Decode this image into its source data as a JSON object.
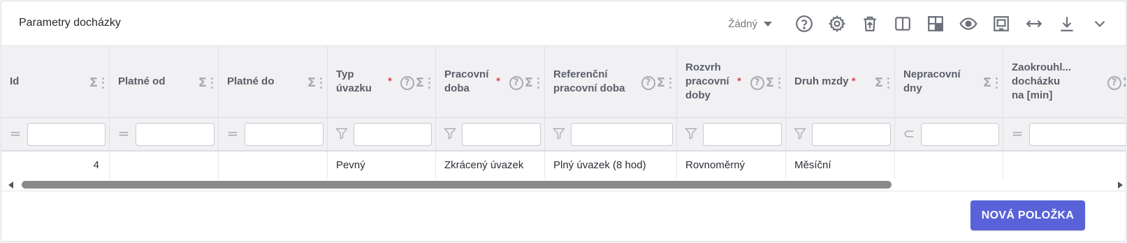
{
  "panel": {
    "title": "Parametry docházky",
    "view_select": "Žádný"
  },
  "toolbar": {
    "icons": [
      "help-icon",
      "gear-icon",
      "trash-upload-icon",
      "columns-icon",
      "layout-icon",
      "eye-icon",
      "fit-icon",
      "horizontal-arrows-icon",
      "download-icon",
      "chevron-down-icon"
    ]
  },
  "columns": [
    {
      "label": "Id",
      "required": "",
      "help": false,
      "filter_op": "="
    },
    {
      "label": "Platné od",
      "required": "",
      "help": false,
      "filter_op": "="
    },
    {
      "label": "Platné do",
      "required": "",
      "help": false,
      "filter_op": "="
    },
    {
      "label": "Typ úvazku",
      "required": "*",
      "help": true,
      "filter_op": "funnel"
    },
    {
      "label": "Pracovní doba",
      "required": "*",
      "help": true,
      "filter_op": "funnel"
    },
    {
      "label": "Referenční pracovní doba",
      "required": "",
      "help": true,
      "filter_op": "funnel"
    },
    {
      "label": "Rozvrh pracovní doby",
      "required": "*",
      "help": true,
      "filter_op": "funnel"
    },
    {
      "label": "Druh mzdy",
      "required": "*",
      "help": false,
      "filter_op": "funnel"
    },
    {
      "label": "Nepracovní dny",
      "required": "",
      "help": false,
      "filter_op": "⊂"
    },
    {
      "label": "Zaokrouhl... docházku na [min]",
      "required": "",
      "help": true,
      "filter_op": "="
    }
  ],
  "rows": [
    {
      "cells": [
        "4",
        "",
        "",
        "Pevný",
        "Zkrácený úvazek",
        "Plný úvazek (8 hod)",
        "Rovnoměrný",
        "Měsíční",
        "",
        ""
      ]
    }
  ],
  "sigma": "Σ",
  "help_glyph": "?",
  "footer": {
    "new_button": "NOVÁ POLOŽKA"
  },
  "colors": {
    "accent": "#5a62d9",
    "required": "#e0474c",
    "header_bg": "#f1f1f4"
  }
}
